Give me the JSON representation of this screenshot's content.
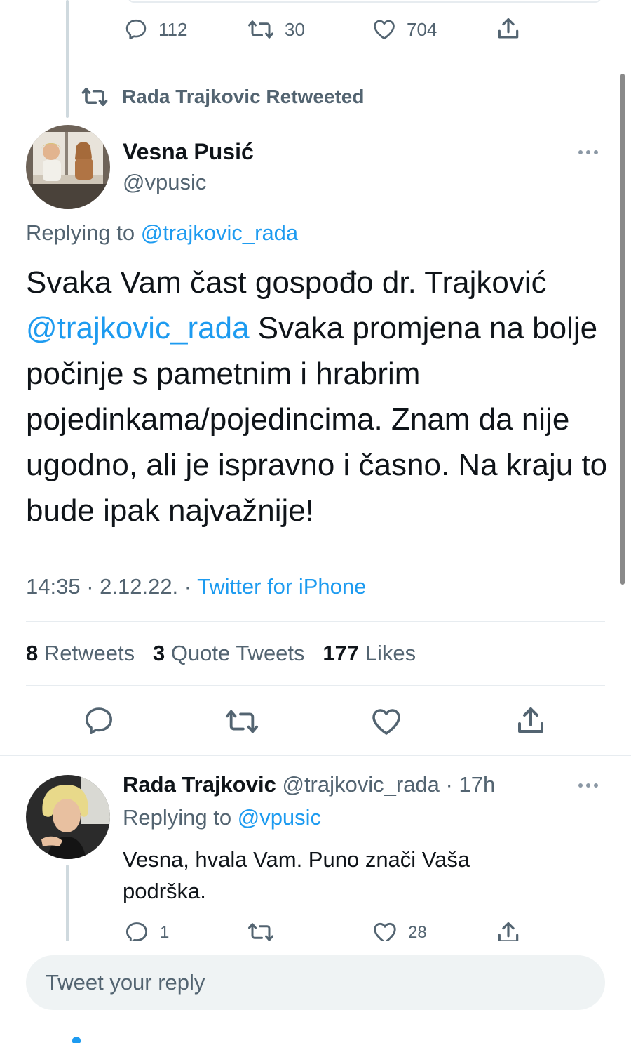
{
  "prev_tweet": {
    "actions": {
      "replies": "112",
      "retweets": "30",
      "likes": "704"
    }
  },
  "retweet_banner": {
    "text": "Rada Trajkovic Retweeted"
  },
  "main_tweet": {
    "author_name": "Vesna Pusić",
    "author_handle": "@vpusic",
    "replying_prefix": "Replying to",
    "replying_to": "@trajkovic_rada",
    "text_part1": "Svaka Vam čast gospođo dr. Trajković",
    "mention": "@trajkovic_rada",
    "text_part2": " Svaka promjena na bolje počinje s pametnim i hrabrim pojedinkama/pojedincima. Znam da nije ugodno, ali je ispravno i časno. Na kraju to bude ipak najvažnije!",
    "timestamp": "14:35 · 2.12.22. · ",
    "source": "Twitter for iPhone",
    "stats": {
      "retweets_count": "8",
      "retweets_label": "Retweets",
      "quotes_count": "3",
      "quotes_label": "Quote Tweets",
      "likes_count": "177",
      "likes_label": "Likes"
    }
  },
  "reply_tweet": {
    "author_name": "Rada Trajkovic",
    "author_handle": "@trajkovic_rada",
    "time": " · 17h",
    "replying_prefix": "Replying to",
    "replying_to": "@vpusic",
    "text": "Vesna, hvala Vam. Puno znači Vaša podrška.",
    "actions": {
      "replies": "1",
      "likes": "28"
    }
  },
  "composer": {
    "placeholder": "Tweet your reply"
  },
  "colors": {
    "accent": "#1d9bf0",
    "muted": "#536471",
    "text": "#0f1419"
  }
}
